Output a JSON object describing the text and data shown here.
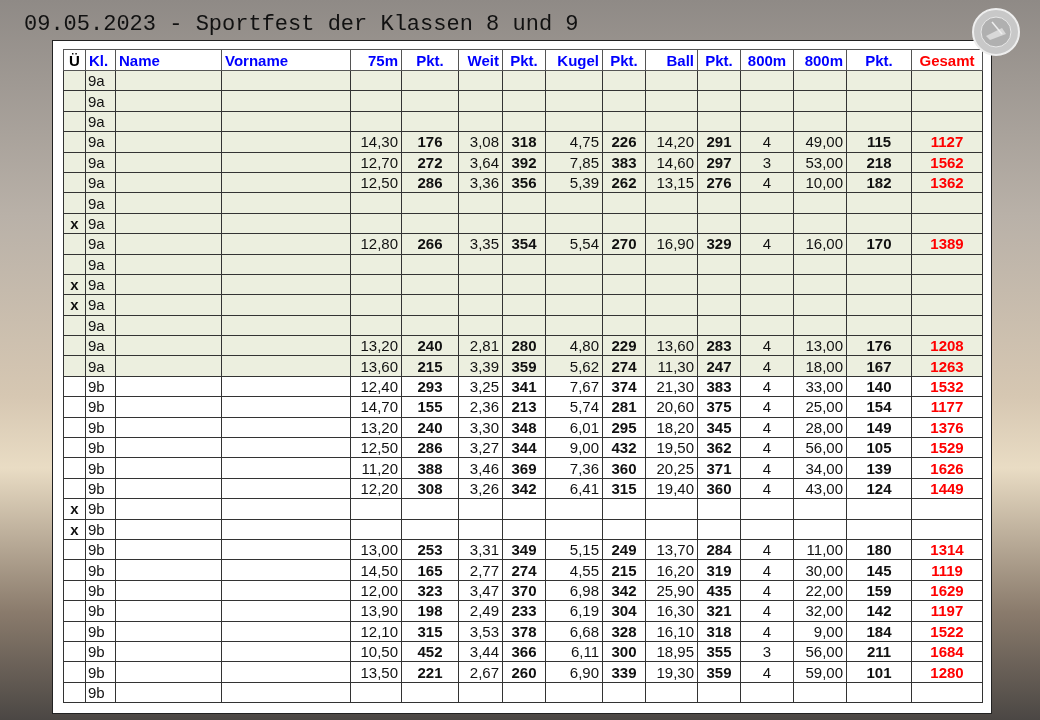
{
  "title": "09.05.2023 - Sportfest der Klassen 8 und 9",
  "table": {
    "columns": [
      {
        "label": "Ü",
        "kind": "mark",
        "color": "#000000"
      },
      {
        "label": "Kl.",
        "kind": "class",
        "color": "#0000ff"
      },
      {
        "label": "Name",
        "kind": "text",
        "color": "#0000ff"
      },
      {
        "label": "Vorname",
        "kind": "text",
        "color": "#0000ff"
      },
      {
        "label": "75m",
        "kind": "measure",
        "color": "#0000ff"
      },
      {
        "label": "Pkt.",
        "kind": "points",
        "color": "#0000ff"
      },
      {
        "label": "Weit",
        "kind": "measure",
        "color": "#0000ff"
      },
      {
        "label": "Pkt.",
        "kind": "points",
        "color": "#0000ff"
      },
      {
        "label": "Kugel",
        "kind": "measure",
        "color": "#0000ff"
      },
      {
        "label": "Pkt.",
        "kind": "points",
        "color": "#0000ff"
      },
      {
        "label": "Ball",
        "kind": "measure",
        "color": "#0000ff"
      },
      {
        "label": "Pkt.",
        "kind": "points",
        "color": "#0000ff"
      },
      {
        "label": "800m",
        "kind": "count",
        "color": "#0000ff"
      },
      {
        "label": "800m",
        "kind": "measure",
        "color": "#0000ff"
      },
      {
        "label": "Pkt.",
        "kind": "points",
        "color": "#0000ff"
      },
      {
        "label": "Gesamt",
        "kind": "total",
        "color": "#ff0000"
      }
    ],
    "rows": [
      {
        "mark": "",
        "class": "9a",
        "highlighted": true
      },
      {
        "mark": "",
        "class": "9a",
        "highlighted": true
      },
      {
        "mark": "",
        "class": "9a",
        "highlighted": true
      },
      {
        "mark": "",
        "class": "9a",
        "highlighted": true,
        "results": [
          "14,30",
          "176",
          "3,08",
          "318",
          "4,75",
          "226",
          "14,20",
          "291",
          "4",
          "49,00",
          "115",
          "1127"
        ]
      },
      {
        "mark": "",
        "class": "9a",
        "highlighted": true,
        "results": [
          "12,70",
          "272",
          "3,64",
          "392",
          "7,85",
          "383",
          "14,60",
          "297",
          "3",
          "53,00",
          "218",
          "1562"
        ]
      },
      {
        "mark": "",
        "class": "9a",
        "highlighted": true,
        "results": [
          "12,50",
          "286",
          "3,36",
          "356",
          "5,39",
          "262",
          "13,15",
          "276",
          "4",
          "10,00",
          "182",
          "1362"
        ]
      },
      {
        "mark": "",
        "class": "9a",
        "highlighted": true
      },
      {
        "mark": "x",
        "class": "9a",
        "highlighted": true
      },
      {
        "mark": "",
        "class": "9a",
        "highlighted": true,
        "results": [
          "12,80",
          "266",
          "3,35",
          "354",
          "5,54",
          "270",
          "16,90",
          "329",
          "4",
          "16,00",
          "170",
          "1389"
        ]
      },
      {
        "mark": "",
        "class": "9a",
        "highlighted": true
      },
      {
        "mark": "x",
        "class": "9a",
        "highlighted": true
      },
      {
        "mark": "x",
        "class": "9a",
        "highlighted": true
      },
      {
        "mark": "",
        "class": "9a",
        "highlighted": true
      },
      {
        "mark": "",
        "class": "9a",
        "highlighted": true,
        "results": [
          "13,20",
          "240",
          "2,81",
          "280",
          "4,80",
          "229",
          "13,60",
          "283",
          "4",
          "13,00",
          "176",
          "1208"
        ]
      },
      {
        "mark": "",
        "class": "9a",
        "highlighted": true,
        "results": [
          "13,60",
          "215",
          "3,39",
          "359",
          "5,62",
          "274",
          "11,30",
          "247",
          "4",
          "18,00",
          "167",
          "1263"
        ]
      },
      {
        "mark": "",
        "class": "9b",
        "highlighted": false,
        "results": [
          "12,40",
          "293",
          "3,25",
          "341",
          "7,67",
          "374",
          "21,30",
          "383",
          "4",
          "33,00",
          "140",
          "1532"
        ]
      },
      {
        "mark": "",
        "class": "9b",
        "highlighted": false,
        "results": [
          "14,70",
          "155",
          "2,36",
          "213",
          "5,74",
          "281",
          "20,60",
          "375",
          "4",
          "25,00",
          "154",
          "1177"
        ]
      },
      {
        "mark": "",
        "class": "9b",
        "highlighted": false,
        "results": [
          "13,20",
          "240",
          "3,30",
          "348",
          "6,01",
          "295",
          "18,20",
          "345",
          "4",
          "28,00",
          "149",
          "1376"
        ]
      },
      {
        "mark": "",
        "class": "9b",
        "highlighted": false,
        "results": [
          "12,50",
          "286",
          "3,27",
          "344",
          "9,00",
          "432",
          "19,50",
          "362",
          "4",
          "56,00",
          "105",
          "1529"
        ]
      },
      {
        "mark": "",
        "class": "9b",
        "highlighted": false,
        "results": [
          "11,20",
          "388",
          "3,46",
          "369",
          "7,36",
          "360",
          "20,25",
          "371",
          "4",
          "34,00",
          "139",
          "1626"
        ]
      },
      {
        "mark": "",
        "class": "9b",
        "highlighted": false,
        "results": [
          "12,20",
          "308",
          "3,26",
          "342",
          "6,41",
          "315",
          "19,40",
          "360",
          "4",
          "43,00",
          "124",
          "1449"
        ]
      },
      {
        "mark": "x",
        "class": "9b",
        "highlighted": false
      },
      {
        "mark": "x",
        "class": "9b",
        "highlighted": false
      },
      {
        "mark": "",
        "class": "9b",
        "highlighted": false,
        "results": [
          "13,00",
          "253",
          "3,31",
          "349",
          "5,15",
          "249",
          "13,70",
          "284",
          "4",
          "11,00",
          "180",
          "1314"
        ]
      },
      {
        "mark": "",
        "class": "9b",
        "highlighted": false,
        "results": [
          "14,50",
          "165",
          "2,77",
          "274",
          "4,55",
          "215",
          "16,20",
          "319",
          "4",
          "30,00",
          "145",
          "1119"
        ]
      },
      {
        "mark": "",
        "class": "9b",
        "highlighted": false,
        "results": [
          "12,00",
          "323",
          "3,47",
          "370",
          "6,98",
          "342",
          "25,90",
          "435",
          "4",
          "22,00",
          "159",
          "1629"
        ]
      },
      {
        "mark": "",
        "class": "9b",
        "highlighted": false,
        "results": [
          "13,90",
          "198",
          "2,49",
          "233",
          "6,19",
          "304",
          "16,30",
          "321",
          "4",
          "32,00",
          "142",
          "1197"
        ]
      },
      {
        "mark": "",
        "class": "9b",
        "highlighted": false,
        "results": [
          "12,10",
          "315",
          "3,53",
          "378",
          "6,68",
          "328",
          "16,10",
          "318",
          "4",
          "9,00",
          "184",
          "1522"
        ]
      },
      {
        "mark": "",
        "class": "9b",
        "highlighted": false,
        "results": [
          "10,50",
          "452",
          "3,44",
          "366",
          "6,11",
          "300",
          "18,95",
          "355",
          "3",
          "56,00",
          "211",
          "1684"
        ]
      },
      {
        "mark": "",
        "class": "9b",
        "highlighted": false,
        "results": [
          "13,50",
          "221",
          "2,67",
          "260",
          "6,90",
          "339",
          "19,30",
          "359",
          "4",
          "59,00",
          "101",
          "1280"
        ]
      },
      {
        "mark": "",
        "class": "9b",
        "highlighted": false
      }
    ]
  }
}
